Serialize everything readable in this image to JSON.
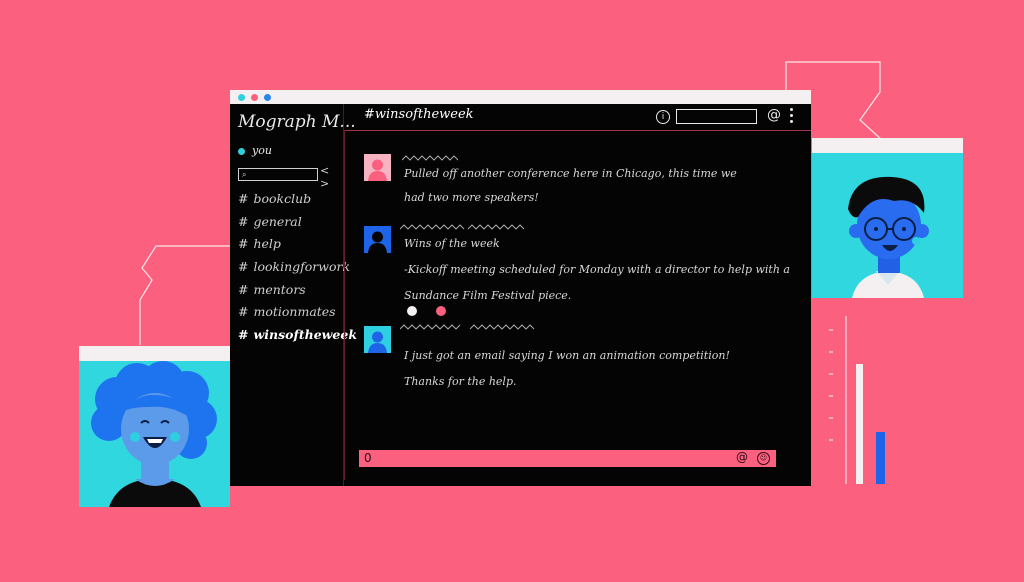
{
  "sidebar": {
    "workspace_name": "Mograph M...",
    "current_user": "you",
    "nav_arrows": "< >",
    "channels": [
      {
        "label": "bookclub"
      },
      {
        "label": "general"
      },
      {
        "label": "help"
      },
      {
        "label": "lookingforwork"
      },
      {
        "label": "mentors"
      },
      {
        "label": "motionmates"
      },
      {
        "label": "winsoftheweek"
      }
    ]
  },
  "header": {
    "channel_title": "#winsoftheweek"
  },
  "messages": [
    {
      "lines": [
        "Pulled off another conference here in Chicago, this time we",
        "had two more speakers!"
      ],
      "avatar_color": "#fb607f"
    },
    {
      "lines": [
        "Wins of the week",
        "-Kickoff meeting scheduled for Monday with a director to help with a",
        "Sundance Film Festival piece."
      ],
      "avatar_color": "#1e64e8"
    },
    {
      "lines": [
        "I just got an email saying I won an animation competition!",
        "Thanks for the help."
      ],
      "avatar_color": "#2ecfe0"
    }
  ],
  "icons": {
    "hash": "#",
    "info": "i",
    "at": "@",
    "attach": "0",
    "search": "⌕",
    "emoji": "☺"
  },
  "colors": {
    "background": "#fb607f",
    "window": "#040404",
    "accent_cyan": "#2ecfe0",
    "accent_blue": "#1e64e8",
    "accent_pink": "#fb607f"
  }
}
